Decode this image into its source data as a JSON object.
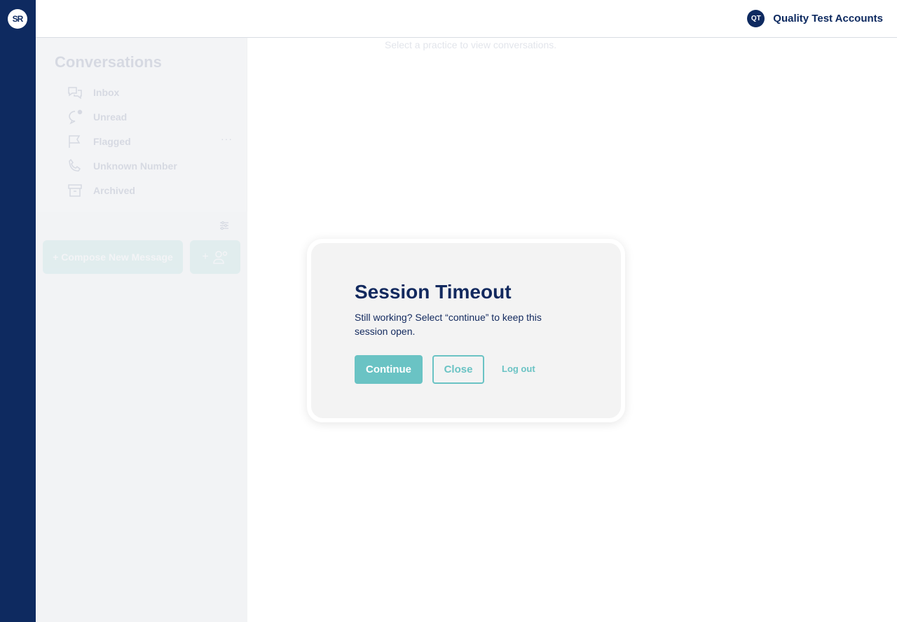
{
  "brand": {
    "logo_text": "SR"
  },
  "header": {
    "account_initials": "QT",
    "account_name": "Quality Test Accounts"
  },
  "sidebar": {
    "title": "Conversations",
    "items": [
      {
        "label": "Inbox",
        "icon": "chat-bubbles-icon"
      },
      {
        "label": "Unread",
        "icon": "unread-bubble-icon"
      },
      {
        "label": "Flagged",
        "icon": "flag-icon"
      },
      {
        "label": "Unknown Number",
        "icon": "phone-icon"
      },
      {
        "label": "Archived",
        "icon": "archive-box-icon"
      }
    ],
    "more_label": "···",
    "compose_label": "+ Compose New Message",
    "add_contact_label": "+"
  },
  "main": {
    "hint": "Select a practice to view conversations."
  },
  "dialog": {
    "title": "Session Timeout",
    "message": "Still working? Select “continue” to keep this session open.",
    "continue_label": "Continue",
    "close_label": "Close",
    "logout_label": "Log out"
  },
  "colors": {
    "navy": "#0e2a60",
    "teal": "#6ac3c4",
    "dialog_bg": "#f3f3f3"
  }
}
